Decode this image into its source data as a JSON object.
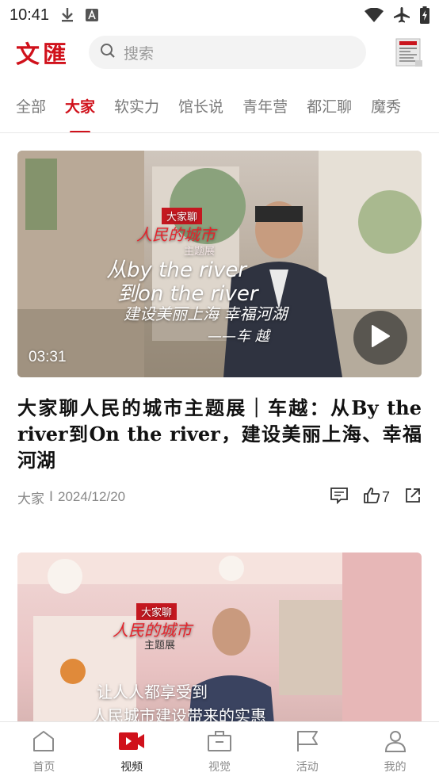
{
  "status_bar": {
    "time": "10:41",
    "icons": [
      "download-icon",
      "a-square-icon",
      "wifi-icon",
      "airplane-icon",
      "battery-charging-icon"
    ]
  },
  "header": {
    "logo": "文匯",
    "search_placeholder": "搜索",
    "newspaper_icon": "newspaper-icon"
  },
  "tabs": [
    {
      "label": "全部",
      "active": false
    },
    {
      "label": "大家",
      "active": true
    },
    {
      "label": "软实力",
      "active": false
    },
    {
      "label": "馆长说",
      "active": false
    },
    {
      "label": "青年营",
      "active": false
    },
    {
      "label": "都汇聊",
      "active": false
    },
    {
      "label": "魔秀",
      "active": false
    }
  ],
  "feed": [
    {
      "duration": "03:31",
      "overlay": {
        "badge": "大家聊",
        "headline": "人民的城市",
        "subhead": "主题展",
        "line1": "从by the river",
        "line2": "到on the river",
        "line3": "建设美丽上海 幸福河湖",
        "line4": "——车 越"
      },
      "title": "大家聊人民的城市主题展｜车越：从By the river到On the river，建设美丽上海、幸福河湖",
      "source": "大家",
      "separator": "I",
      "date": "2024/12/20",
      "likes": "7"
    },
    {
      "overlay": {
        "badge": "大家聊",
        "headline": "人民的城市",
        "subhead": "主题展",
        "line1": "让人人都享受到",
        "line2": "人民城市建设带来的实惠"
      }
    }
  ],
  "bottom_nav": [
    {
      "label": "首页",
      "icon": "home-icon",
      "active": false
    },
    {
      "label": "视频",
      "icon": "video-icon",
      "active": true
    },
    {
      "label": "视觉",
      "icon": "camera-icon",
      "active": false
    },
    {
      "label": "活动",
      "icon": "flag-icon",
      "active": false
    },
    {
      "label": "我的",
      "icon": "user-icon",
      "active": false
    }
  ],
  "colors": {
    "brand": "#d0111b",
    "tab_inactive": "#7a7a7a",
    "meta_text": "#888888"
  }
}
